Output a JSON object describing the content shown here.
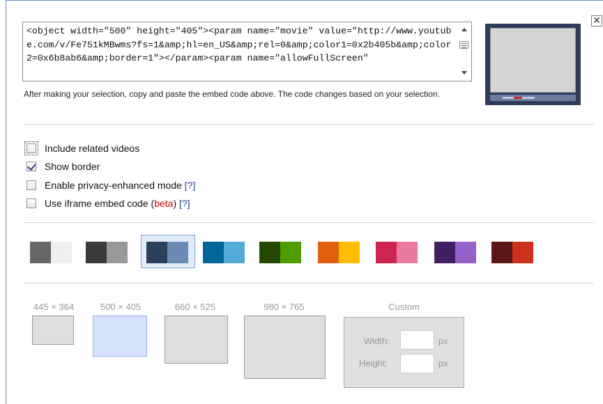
{
  "embed": {
    "code": "<object width=\"500\" height=\"405\"><param name=\"movie\" value=\"http://www.youtube.com/v/Fe751kMBwms?fs=1&amp;hl=en_US&amp;rel=0&amp;color1=0x2b405b&amp;color2=0x6b8ab6&amp;border=1\"></param><param name=\"allowFullScreen\"",
    "hint": "After making your selection, copy and paste the embed code above. The code changes based on your selection."
  },
  "close_label": "✕",
  "options": [
    {
      "label": "Include related videos",
      "checked": false,
      "focused": true
    },
    {
      "label": "Show border",
      "checked": true
    },
    {
      "label": "Enable privacy-enhanced mode",
      "help": "[?]",
      "checked": false
    },
    {
      "label_before": "Use iframe embed code (",
      "beta": "beta",
      "label_after": ")",
      "help": "[?]",
      "checked": false
    }
  ],
  "color_schemes": [
    {
      "color1": "#666666",
      "color2": "#efefef"
    },
    {
      "color1": "#3a3a3a",
      "color2": "#999999"
    },
    {
      "color1": "#2b405b",
      "color2": "#6b8ab6",
      "selected": true
    },
    {
      "color1": "#006699",
      "color2": "#54abd6"
    },
    {
      "color1": "#234900",
      "color2": "#4e9e00"
    },
    {
      "color1": "#e1600f",
      "color2": "#febd01"
    },
    {
      "color1": "#cc2550",
      "color2": "#e87a9f"
    },
    {
      "color1": "#402061",
      "color2": "#9461ca"
    },
    {
      "color1": "#5d1719",
      "color2": "#cd311b"
    }
  ],
  "sizes": [
    {
      "label": "445 × 364"
    },
    {
      "label": "500 × 405",
      "selected": true
    },
    {
      "label": "660 × 525"
    },
    {
      "label": "980 × 765"
    }
  ],
  "custom": {
    "label": "Custom",
    "width_label": "Width:",
    "height_label": "Height:",
    "unit": "px",
    "width_value": "",
    "height_value": ""
  }
}
